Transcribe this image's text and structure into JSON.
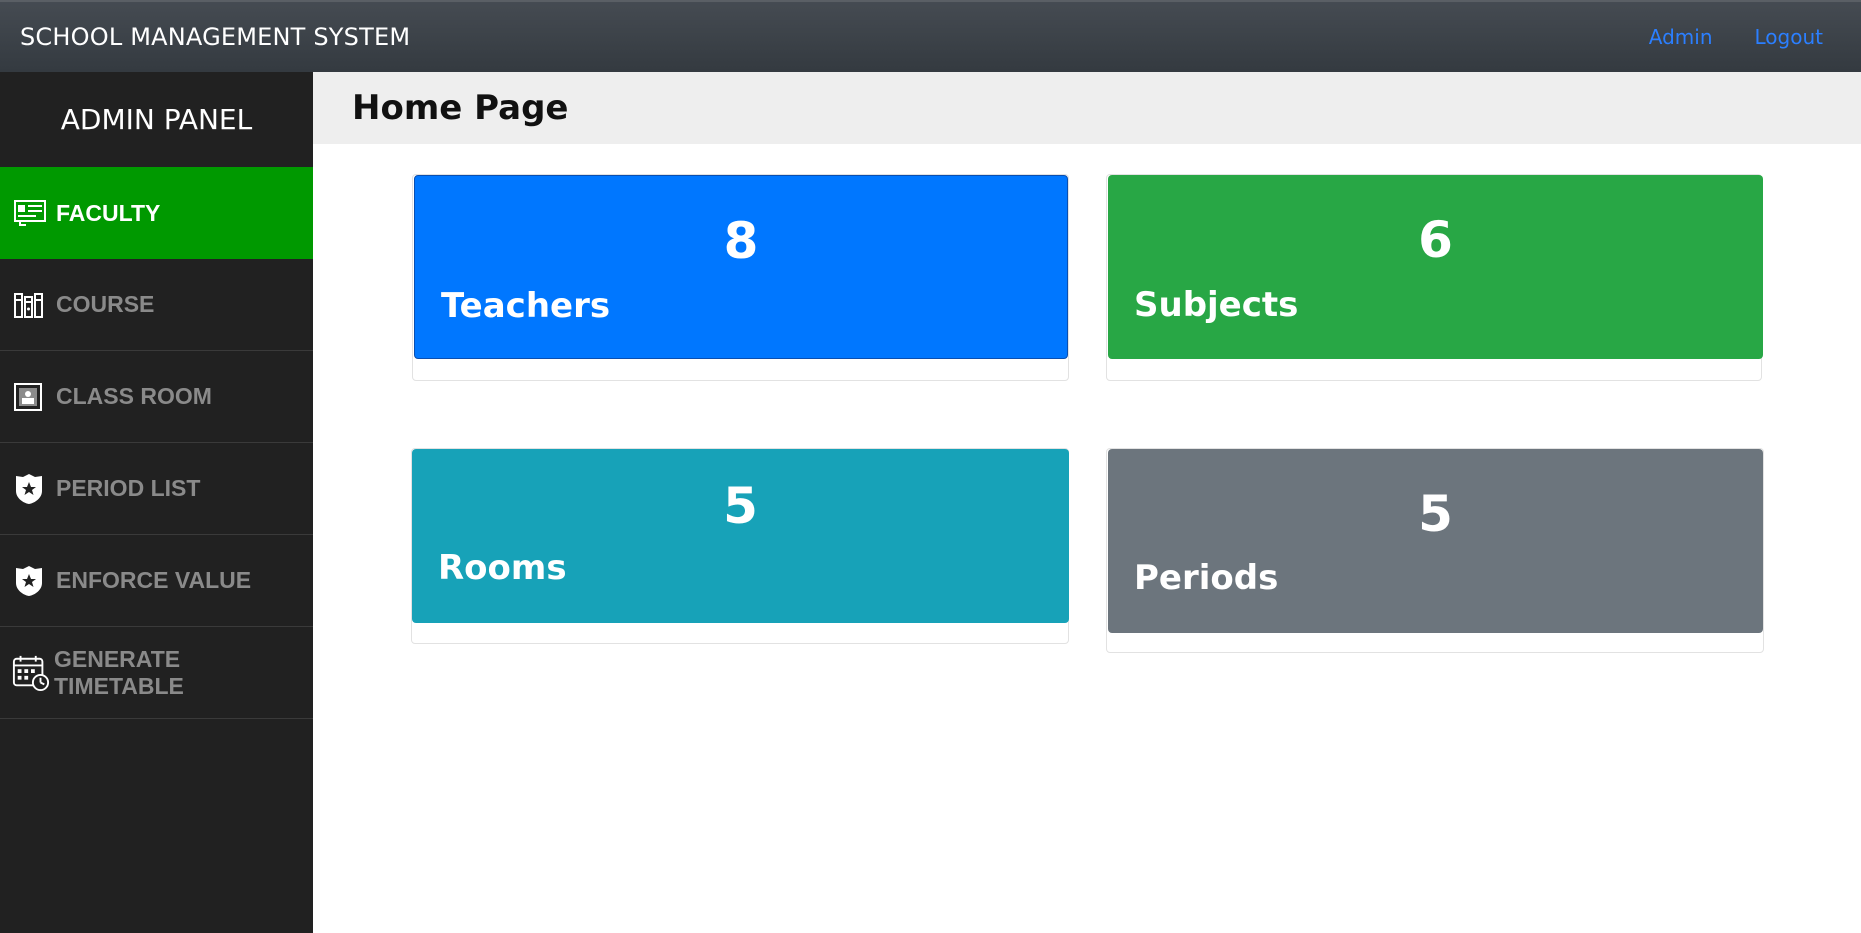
{
  "header": {
    "brand": "SCHOOL MANAGEMENT SYSTEM",
    "admin_label": "Admin",
    "logout_label": "Logout",
    "link_color": "#2b7fff"
  },
  "sidebar": {
    "title": "ADMIN PANEL",
    "items": [
      {
        "label": "FACULTY",
        "icon": "id-card-icon",
        "active": true
      },
      {
        "label": "COURSE",
        "icon": "books-icon",
        "active": false
      },
      {
        "label": "CLASS ROOM",
        "icon": "classroom-icon",
        "active": false
      },
      {
        "label": "PERIOD LIST",
        "icon": "badge-icon",
        "active": false
      },
      {
        "label": "ENFORCE VALUE",
        "icon": "badge-icon",
        "active": false
      },
      {
        "label": "GENERATE TIMETABLE",
        "icon": "calendar-clock-icon",
        "active": false
      }
    ],
    "active_color": "#009900"
  },
  "main": {
    "title": "Home Page",
    "cards": [
      {
        "count": "8",
        "label": "Teachers",
        "color": "#0077ff"
      },
      {
        "count": "6",
        "label": "Subjects",
        "color": "#28a745"
      },
      {
        "count": "5",
        "label": "Rooms",
        "color": "#17a2b8"
      },
      {
        "count": "5",
        "label": "Periods",
        "color": "#6c757d"
      }
    ]
  }
}
